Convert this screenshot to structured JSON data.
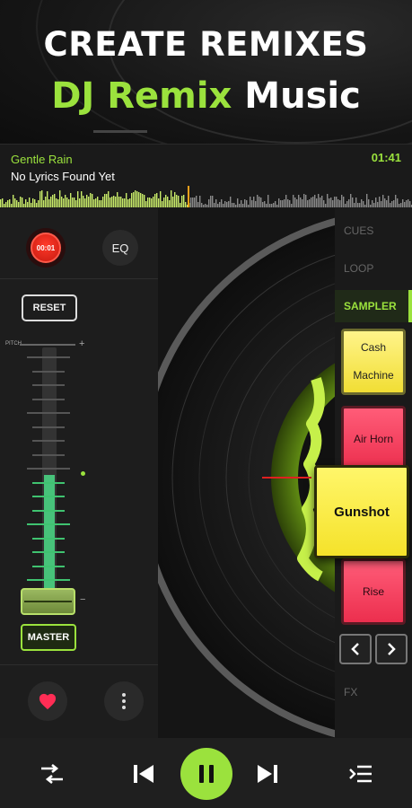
{
  "promo": {
    "headline": "CREATE REMIXES",
    "sub_accent": "DJ Remix",
    "sub_rest": "Music"
  },
  "track": {
    "title": "Gentle Rain",
    "lyrics": "No Lyrics Found Yet",
    "time": "01:41",
    "progress": 0.46
  },
  "controls": {
    "rec_label": "00:01",
    "eq_label": "EQ",
    "reset_label": "RESET",
    "pitch_label": "PITCH",
    "pitch_plus": "+",
    "pitch_minus": "−",
    "master_label": "MASTER",
    "pitch_level": 0.0
  },
  "side_tabs": {
    "cues": "CUES",
    "loop": "LOOP",
    "sampler": "SAMPLER",
    "fx": "FX"
  },
  "pads": {
    "pad1_line1": "Cash",
    "pad1_line2": "Machine",
    "pad2": "Air Horn",
    "pad3": "Gunshot",
    "pad4": "Rise"
  },
  "icons": {
    "heart": "heart-icon",
    "more": "more-vertical-icon",
    "shuffle": "shuffle-icon",
    "prev": "skip-previous-icon",
    "pause": "pause-icon",
    "next": "skip-next-icon",
    "queue": "queue-icon",
    "arrow_left": "chevron-left-icon",
    "arrow_right": "chevron-right-icon"
  },
  "colors": {
    "accent": "#9be23d",
    "record": "#e8281a",
    "pad_yellow": "#f5e22a",
    "pad_red": "#ec2f4e"
  }
}
